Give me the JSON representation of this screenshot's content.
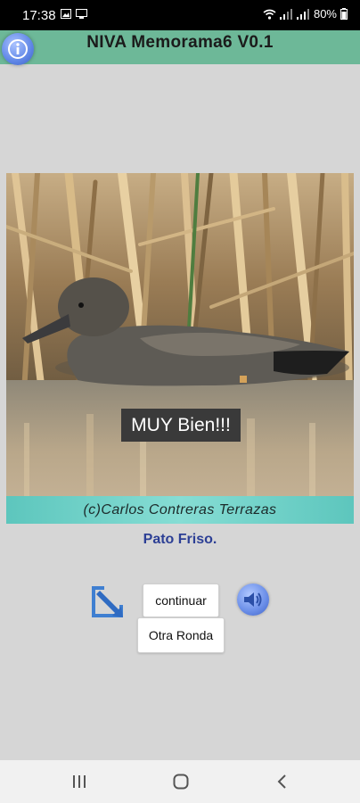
{
  "status_bar": {
    "time": "17:38",
    "battery": "80%"
  },
  "app": {
    "title": "NIVA Memorama6 V0.1"
  },
  "photo": {
    "feedback": "MUY Bien!!!",
    "credit": "(c)Carlos Contreras Terrazas"
  },
  "bird_name": "Pato Friso.",
  "buttons": {
    "continue": "continuar",
    "new_round": "Otra Ronda"
  },
  "icons": {
    "info": "info-icon",
    "reduce": "arrow-reduce-icon",
    "sound": "speaker-icon",
    "recent": "recent-apps-icon",
    "home": "home-icon",
    "back": "back-icon"
  },
  "colors": {
    "app_bar": "#6db898",
    "bird_name": "#2c3f95",
    "credit_band": "#5dc6bd",
    "background": "#d6d6d6"
  }
}
